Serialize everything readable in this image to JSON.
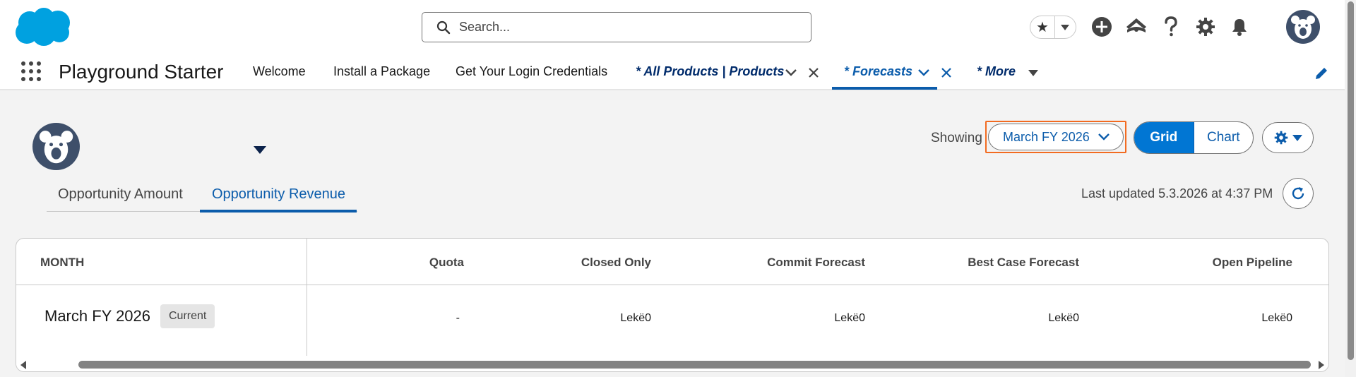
{
  "header": {
    "search_placeholder": "Search...",
    "icons": [
      "favorites-star-icon",
      "favorites-dropdown-icon",
      "global-actions-add-icon",
      "trailhead-guidance-icon",
      "help-icon",
      "setup-gear-icon",
      "notifications-bell-icon",
      "user-avatar"
    ]
  },
  "nav": {
    "app_name": "Playground Starter",
    "items": [
      {
        "label": "Welcome"
      },
      {
        "label": "Install a Package"
      },
      {
        "label": "Get Your Login Credentials"
      }
    ],
    "tabs": [
      {
        "label": "* All Products | Products"
      },
      {
        "label": "* Forecasts",
        "active": true
      },
      {
        "label": "* More"
      }
    ]
  },
  "forecast": {
    "subtabs": [
      {
        "label": "Opportunity Amount"
      },
      {
        "label": "Opportunity Revenue",
        "active": true
      }
    ],
    "showing_label": "Showing",
    "period": "March FY 2026",
    "view_toggle": {
      "grid": "Grid",
      "chart": "Chart",
      "selected": "Grid"
    },
    "last_updated": "Last updated 5.3.2026 at 4:37 PM"
  },
  "table": {
    "columns": [
      "MONTH",
      "Quota",
      "Closed Only",
      "Commit Forecast",
      "Best Case Forecast",
      "Open Pipeline"
    ],
    "rows": [
      {
        "month": "March FY 2026",
        "badge": "Current",
        "quota": "-",
        "closed_only": "Lekë0",
        "commit": "Lekë0",
        "best_case": "Lekë0",
        "open_pipeline": "Lekë0"
      }
    ]
  },
  "colors": {
    "brand_blue": "#0176d3",
    "link_blue": "#0b5cab",
    "focus_orange": "#f26b21",
    "salesforce_cloud": "#00a1e0"
  }
}
